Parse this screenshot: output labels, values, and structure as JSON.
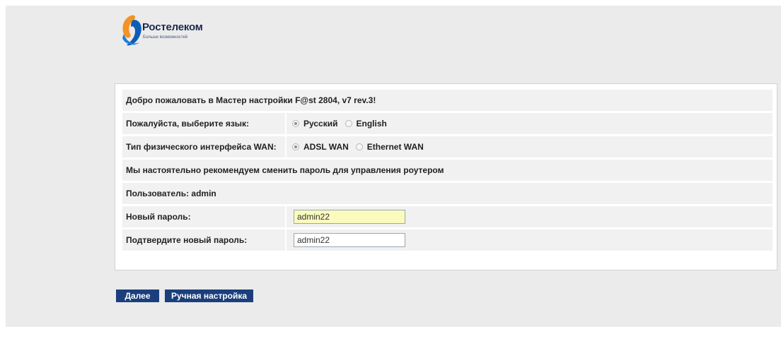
{
  "brand": {
    "name": "Ростелеком",
    "tagline": "Больше возможностей",
    "colors": {
      "orange": "#f39323",
      "blue": "#0f5db5",
      "navy": "#1b3f7c"
    }
  },
  "wizard": {
    "welcome": "Добро пожаловать в Мастер настройки F@st 2804, v7 rev.3!",
    "language": {
      "label": "Пожалуйста, выберите язык:",
      "options": [
        "Русский",
        "English"
      ],
      "selected": "Русский"
    },
    "wan": {
      "label": "Тип физического интерфейса WAN:",
      "options": [
        "ADSL WAN",
        "Ethernet WAN"
      ],
      "selected": "ADSL WAN"
    },
    "recommend": "Мы настоятельно рекомендуем сменить пароль для управления роутером",
    "user": "Пользователь: admin",
    "new_password": {
      "label": "Новый пароль:",
      "value": "admin22"
    },
    "confirm_password": {
      "label": "Подтвердите новый пароль:",
      "value": "admin22"
    }
  },
  "buttons": {
    "next": "Далее",
    "manual": "Ручная настройка"
  }
}
